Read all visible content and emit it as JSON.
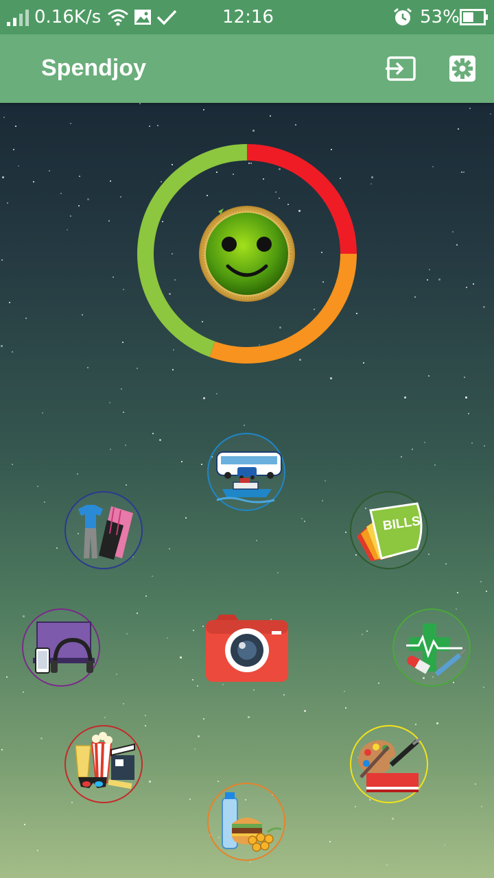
{
  "status_bar": {
    "network_speed": "0.16K/s",
    "time": "12:16",
    "battery_percent": "53%",
    "battery_level": 0.53
  },
  "app_bar": {
    "title": "Spendjoy",
    "actions": [
      "export-icon",
      "gear-icon"
    ]
  },
  "budget_ring": {
    "segments": [
      {
        "color": "#ef1c25",
        "start_deg": 0,
        "end_deg": 90
      },
      {
        "color": "#f7931e",
        "start_deg": 90,
        "end_deg": 200
      },
      {
        "color": "#8dc63f",
        "start_deg": 200,
        "end_deg": 360
      }
    ],
    "face": "smiley-face-icon"
  },
  "categories": [
    {
      "id": "transport",
      "icon": "transport-icon",
      "border": "#1f86c8"
    },
    {
      "id": "clothing",
      "icon": "clothing-icon",
      "border": "#2b3a8f"
    },
    {
      "id": "bills",
      "icon": "bills-icon",
      "label": "BILLS",
      "border": "#2e5a2e"
    },
    {
      "id": "electronics",
      "icon": "electronics-icon",
      "border": "#7b2a8a"
    },
    {
      "id": "camera",
      "icon": "camera-icon"
    },
    {
      "id": "health",
      "icon": "health-icon",
      "border": "#49a83a"
    },
    {
      "id": "entertainment",
      "icon": "entertainment-icon",
      "border": "#c42a2a"
    },
    {
      "id": "hobbies",
      "icon": "hobbies-icon",
      "border": "#f2e21c"
    },
    {
      "id": "food",
      "icon": "food-icon",
      "border": "#e8822a"
    }
  ]
}
